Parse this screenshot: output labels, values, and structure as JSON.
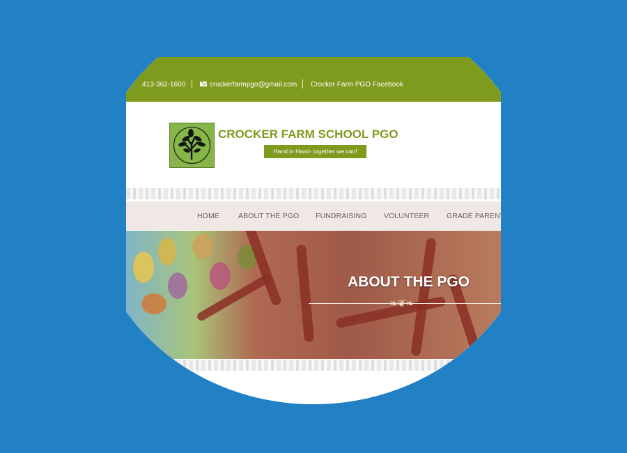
{
  "colors": {
    "background": "#2281c4",
    "brand_green": "#7e9b1e",
    "nav_bg": "#efe8e4",
    "nav_text": "#6a5e59"
  },
  "topbar": {
    "phone": "413-362-1600",
    "email_icon": "envelope-icon",
    "email": "crockerfarmpgo@gmail.com",
    "facebook": "Crocker Farm PGO Facebook"
  },
  "header": {
    "logo_icon": "tree-logo-icon",
    "title": "CROCKER FARM SCHOOL PGO",
    "tagline": "Hand in Hand- together we can!"
  },
  "nav": {
    "items": [
      "HOME",
      "ABOUT THE PGO",
      "FUNDRAISING",
      "VOLUNTEER",
      "GRADE PARENTS"
    ]
  },
  "hero": {
    "title": "ABOUT THE PGO",
    "ornament": "ornament-divider-icon"
  }
}
